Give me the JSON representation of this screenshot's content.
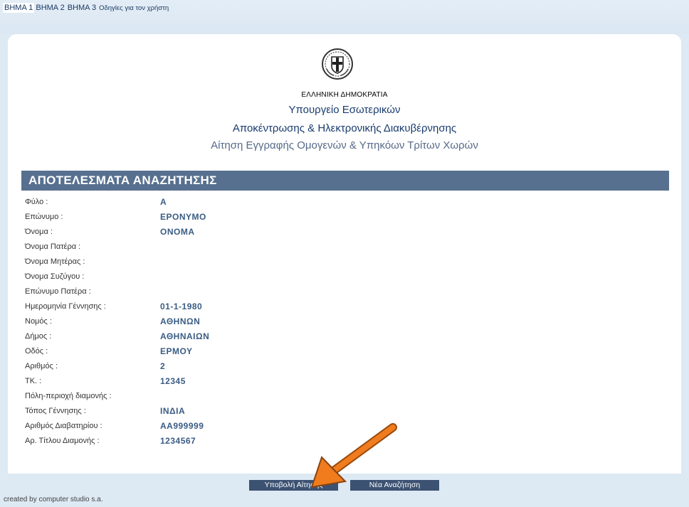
{
  "nav": {
    "tabs": [
      {
        "label": "ΒΗΜΑ 1",
        "active": true
      },
      {
        "label": "ΒΗΜΑ 2",
        "active": false
      },
      {
        "label": "ΒΗΜΑ 3",
        "active": false
      }
    ],
    "help_link": "Οδηγίες για τον χρήστη"
  },
  "header": {
    "emblem_icon": "greek-coat-of-arms",
    "line1": "ΕΛΛΗΝΙΚΗ ΔΗΜΟΚΡΑΤΙΑ",
    "line2": "Υπουργείο Εσωτερικών",
    "line3": "Αποκέντρωσης & Ηλεκτρονικής Διακυβέρνησης",
    "line4": "Αίτηση Εγγραφής Ομογενών & Υπηκόων Τρίτων Χωρών"
  },
  "results": {
    "title": "ΑΠΟΤΕΛΕΣΜΑΤΑ ΑΝΑΖΗΤΗΣΗΣ",
    "fields": [
      {
        "label": "Φύλο :",
        "value": "Α"
      },
      {
        "label": "Επώνυμο :",
        "value": "ΕΡΟΝΥΜΟ"
      },
      {
        "label": "Όνομα :",
        "value": "ΟΝΟΜΑ"
      },
      {
        "label": "Όνομα Πατέρα :",
        "value": ""
      },
      {
        "label": "Όνομα Μητέρας :",
        "value": ""
      },
      {
        "label": "Όνομα Συζύγου :",
        "value": ""
      },
      {
        "label": "Επώνυμο Πατέρα :",
        "value": ""
      },
      {
        "label": "Ημερομηνία Γέννησης :",
        "value": "01-1-1980"
      },
      {
        "label": "Νομός :",
        "value": "ΑΘΗΝΩΝ"
      },
      {
        "label": "Δήμος :",
        "value": "ΑΘΗΝΑΙΩΝ"
      },
      {
        "label": "Οδός :",
        "value": "ΕΡΜΟΥ"
      },
      {
        "label": "Αριθμός :",
        "value": "2"
      },
      {
        "label": "ΤΚ. :",
        "value": "12345"
      },
      {
        "label": "Πόλη-περιοχή διαμονής :",
        "value": ""
      },
      {
        "label": "Τόπος Γέννησης :",
        "value": "ΙΝΔΙΑ"
      },
      {
        "label": "Αριθμός Διαβατηρίου :",
        "value": "ΑΑ999999"
      },
      {
        "label": "Αρ. Τίτλου Διαμονής :",
        "value": "1234567"
      }
    ]
  },
  "buttons": {
    "submit": "Υποβολή Αίτησης",
    "new_search": "Νέα Αναζήτηση"
  },
  "footer": "created by computer studio s.a.",
  "annotation": {
    "icon": "orange-arrow-icon",
    "color": "#f07c1e"
  },
  "colors": {
    "background": "#dde9f3",
    "results_bar": "#57708f",
    "button": "#3c5272",
    "value_text": "#3a5c84"
  }
}
